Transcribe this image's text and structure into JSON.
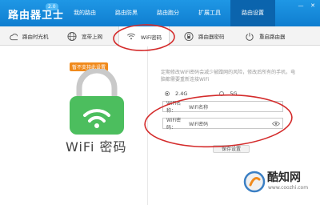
{
  "app": {
    "title": "路由器卫士",
    "version": "2.0"
  },
  "nav": {
    "tabs": [
      {
        "label": "我的路由"
      },
      {
        "label": "路由防黑"
      },
      {
        "label": "路由跑分"
      },
      {
        "label": "扩展工具"
      },
      {
        "label": "路由设置",
        "active": true
      }
    ]
  },
  "window_controls": {
    "minimize": "—",
    "close": "✕"
  },
  "subtabs": [
    {
      "label": "路由时光机",
      "icon": "clock-icon"
    },
    {
      "label": "宽带上网",
      "icon": "globe-icon"
    },
    {
      "label": "WiFi密码",
      "icon": "wifi-icon",
      "active": true
    },
    {
      "label": "路由器密码",
      "icon": "lock-circle-icon"
    },
    {
      "label": "重启路由器",
      "icon": "restart-icon"
    }
  ],
  "left": {
    "badge": "暂不支持此设置",
    "title": "WiFi 密码"
  },
  "right": {
    "notice": "定期修改WiFi密码会减少被蹭网的风险，修改后所有的手机，电脑都需要重新连接WiFi",
    "bands": [
      {
        "label": "2.4G",
        "checked": true
      },
      {
        "label": "5G",
        "checked": false
      }
    ],
    "wifi_name": {
      "label": "WiFi名称：",
      "value": "WiFi名称"
    },
    "wifi_password": {
      "label": "WiFi密码：",
      "value": "WiFi密码"
    },
    "save_label": "保存设置"
  },
  "watermark": {
    "name": "酷知网",
    "url": "www.coozhi.com"
  },
  "colors": {
    "title_bar": "#1487da",
    "active_nav": "#0b64ad",
    "lock_green": "#4cbe5e",
    "annotation_red": "#d42b2b",
    "badge_orange": "#f08a1c"
  }
}
